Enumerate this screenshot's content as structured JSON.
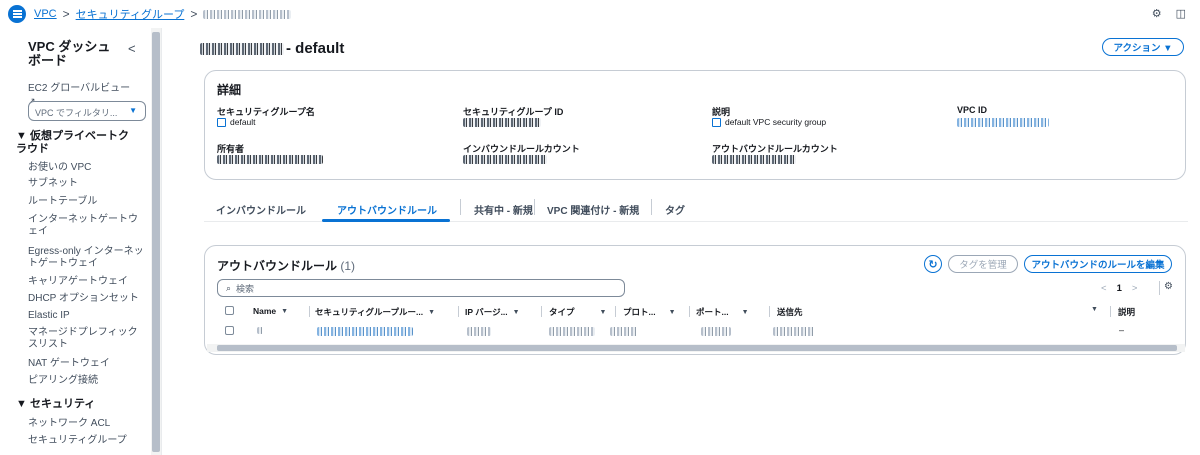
{
  "breadcrumb": {
    "vpc": "VPC",
    "sg": "セキュリティグループ",
    "sep": ">"
  },
  "top_icons": {
    "gear": "⚙",
    "comment": "◫"
  },
  "sidebar": {
    "title": "VPC ダッシュボード",
    "collapse": "<",
    "ec2_global": "EC2 グローバルビュー",
    "filter_placeholder": "VPC でフィルタリ...",
    "sec_vpc": "▼ 仮想プライベートクラウド",
    "items": [
      "お使いの VPC",
      "サブネット",
      "ルートテーブル",
      "インターネットゲートウェイ",
      "Egress-only インターネットゲートウェイ",
      "キャリアゲートウェイ",
      "DHCP オプションセット",
      "Elastic IP",
      "マネージドプレフィックスリスト",
      "NAT ゲートウェイ",
      "ピアリング接続"
    ],
    "sec_security": "▼ セキュリティ",
    "security_items": [
      "ネットワーク ACL",
      "セキュリティグループ"
    ]
  },
  "header": {
    "title_suffix": "- default",
    "actions": "アクション ▼"
  },
  "details": {
    "title": "詳細",
    "sg_name_label": "セキュリティグループ名",
    "sg_name": "default",
    "sg_id_label": "セキュリティグループ ID",
    "desc_label": "説明",
    "desc": "default VPC security group",
    "vpc_id_label": "VPC ID",
    "owner_label": "所有者",
    "inbound_count_label": "インバウンドルールカウント",
    "outbound_count_label": "アウトバウンドルールカウント"
  },
  "tabs": [
    "インバウンドルール",
    "アウトバウンドルール",
    "共有中 - 新規",
    "VPC 関連付け - 新規",
    "タグ"
  ],
  "rules": {
    "title": "アウトバウンドルール",
    "count": "(1)",
    "manage_tags": "タグを管理",
    "edit": "アウトバウンドのルールを編集",
    "search_placeholder": "検索",
    "page": "1",
    "headers": [
      "Name",
      "セキュリティグループルー...",
      "IP バージ...",
      "タイプ",
      "プロト...",
      "ポート...",
      "送信先",
      "説明"
    ],
    "desc_cell": "–"
  },
  "colors": {
    "accent": "#0972d3"
  }
}
